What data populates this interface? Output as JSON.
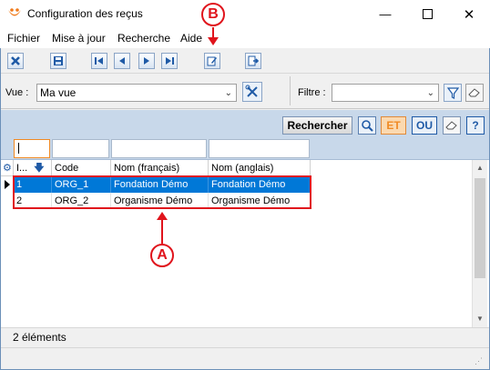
{
  "window": {
    "title": "Configuration des reçus"
  },
  "menu": [
    "Fichier",
    "Mise à jour",
    "Recherche",
    "Aide"
  ],
  "filter_bar": {
    "view_label": "Vue :",
    "view_value": "Ma vue",
    "filter_label": "Filtre :",
    "filter_value": ""
  },
  "search_panel": {
    "search_button": "Rechercher",
    "et_button": "ET",
    "ou_button": "OU",
    "help_button": "?"
  },
  "grid": {
    "columns": [
      "I...",
      "Code",
      "Nom (français)",
      "Nom (anglais)"
    ],
    "rows": [
      {
        "id": "1",
        "code": "ORG_1",
        "nom_fr": "Fondation Démo",
        "nom_en": "Fondation Démo"
      },
      {
        "id": "2",
        "code": "ORG_2",
        "nom_fr": "Organisme Démo",
        "nom_en": "Organisme Démo"
      }
    ]
  },
  "status": {
    "count": "2 éléments"
  },
  "annotations": {
    "a": "A",
    "b": "B"
  },
  "colors": {
    "accent_red": "#e0141c",
    "selection_blue": "#0078d7",
    "panel_blue": "#c8d8ea",
    "toolbar_blue": "#1f5aa6",
    "et_orange": "#f08a24"
  }
}
